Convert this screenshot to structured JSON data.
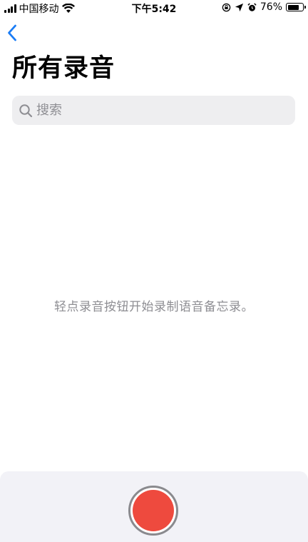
{
  "status_bar": {
    "carrier": "中国移动",
    "time": "下午5:42",
    "battery": "76%",
    "battery_level": 0.76
  },
  "nav": {
    "back_icon": "chevron-left-icon",
    "title": "所有录音"
  },
  "search": {
    "placeholder": "搜索",
    "value": ""
  },
  "empty_state": {
    "message": "轻点录音按钮开始录制语音备忘录。"
  },
  "colors": {
    "accent": "#1a7cf5",
    "record": "#ee4a3e",
    "secondary_text": "#8e8e93"
  }
}
